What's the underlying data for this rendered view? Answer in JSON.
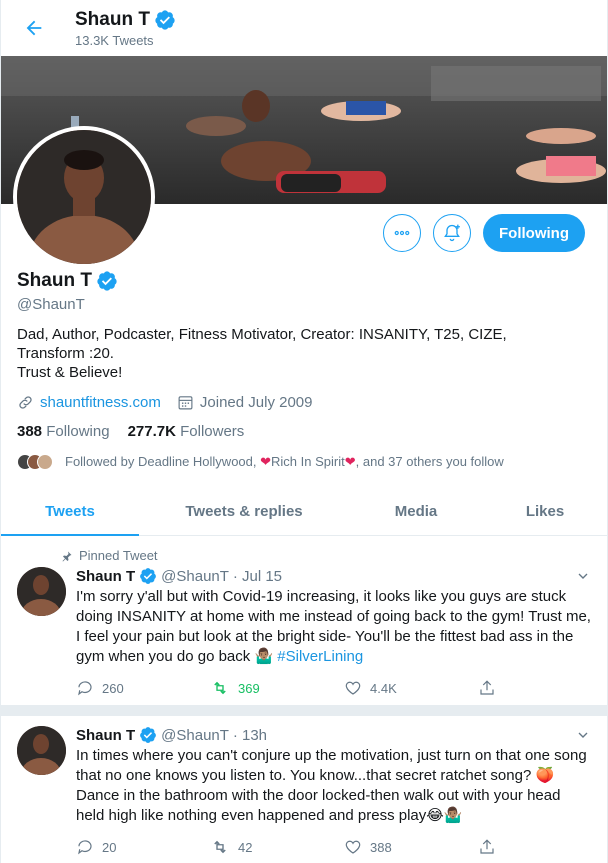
{
  "header": {
    "name": "Shaun T",
    "tweet_count": "13.3K Tweets"
  },
  "profile": {
    "name": "Shaun T",
    "handle": "@ShaunT",
    "bio": "Dad, Author, Podcaster, Fitness Motivator, Creator: INSANITY, T25, CIZE,\nTransform :20.\nTrust & Believe!",
    "website": "shauntfitness.com",
    "joined": "Joined July 2009",
    "following_count": "388",
    "following_label": "Following",
    "followers_count": "277.7K",
    "followers_label": "Followers",
    "followed_by_prefix": "Followed by Deadline Hollywood,",
    "followed_by_rich": "Rich In Spirit",
    "followed_by_suffix": ", and 37 others you follow",
    "following_button": "Following"
  },
  "tabs": [
    "Tweets",
    "Tweets & replies",
    "Media",
    "Likes"
  ],
  "tweets": [
    {
      "pinned_label": "Pinned Tweet",
      "name": "Shaun T",
      "handle_time": "@ShaunT · Jul 15",
      "text": "I'm sorry y'all but with Covid-19 increasing, it looks like you guys are stuck doing INSANITY at home with me instead of going back to the gym! Trust me, I feel your pain but look at the bright side- You'll be the fittest bad ass in the gym when you do go back 🤷🏽‍♂️ ",
      "hashtag": "#SilverLining",
      "replies": "260",
      "retweets": "369",
      "likes": "4.4K"
    },
    {
      "name": "Shaun T",
      "handle_time": "@ShaunT · 13h",
      "text": "In times where you can't conjure up the motivation, just turn on that one song that no one knows you listen to. You know...that secret ratchet song? 🍑 Dance in the bathroom with the door locked-then walk out with your head held high like nothing even happened and press play😂🤷🏽‍♂️",
      "replies": "20",
      "retweets": "42",
      "likes": "388"
    }
  ],
  "colors": {
    "accent": "#1da1f2",
    "retweet": "#17bf63",
    "heart": "#e0245e"
  }
}
